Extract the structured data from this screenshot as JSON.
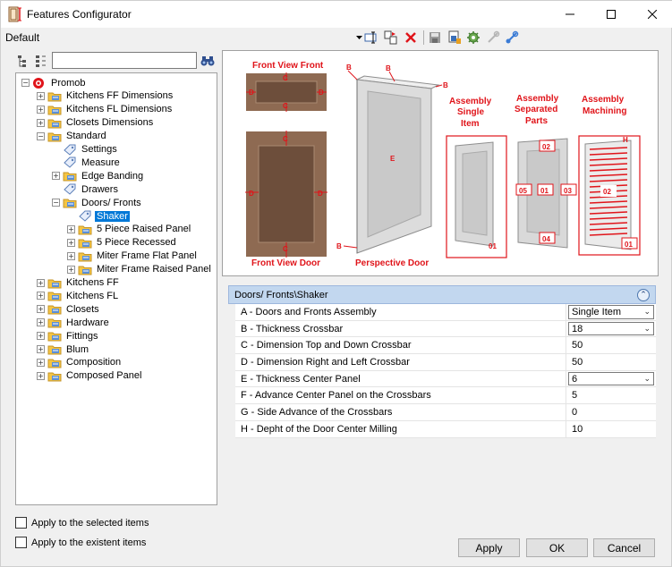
{
  "window": {
    "title": "Features Configurator"
  },
  "toolbar": {
    "preset": "Default"
  },
  "tree": {
    "items": [
      {
        "label": "Promob",
        "level": 0,
        "expander": "−",
        "type": "root"
      },
      {
        "label": "Kitchens FF Dimensions",
        "level": 1,
        "expander": "+",
        "type": "folder"
      },
      {
        "label": "Kitchens FL Dimensions",
        "level": 1,
        "expander": "+",
        "type": "folder"
      },
      {
        "label": "Closets Dimensions",
        "level": 1,
        "expander": "+",
        "type": "folder"
      },
      {
        "label": "Standard",
        "level": 1,
        "expander": "−",
        "type": "folder"
      },
      {
        "label": "Settings",
        "level": 2,
        "expander": "",
        "type": "tag"
      },
      {
        "label": "Measure",
        "level": 2,
        "expander": "",
        "type": "tag"
      },
      {
        "label": "Edge Banding",
        "level": 2,
        "expander": "+",
        "type": "folder"
      },
      {
        "label": "Drawers",
        "level": 2,
        "expander": "",
        "type": "tag"
      },
      {
        "label": "Doors/ Fronts",
        "level": 2,
        "expander": "−",
        "type": "folder"
      },
      {
        "label": "Shaker",
        "level": 3,
        "expander": "",
        "type": "tag",
        "selected": true
      },
      {
        "label": "5 Piece Raised Panel",
        "level": 3,
        "expander": "+",
        "type": "folder"
      },
      {
        "label": "5 Piece Recessed",
        "level": 3,
        "expander": "+",
        "type": "folder"
      },
      {
        "label": "Miter Frame Flat Panel",
        "level": 3,
        "expander": "+",
        "type": "folder"
      },
      {
        "label": "Miter Frame Raised Panel",
        "level": 3,
        "expander": "+",
        "type": "folder"
      },
      {
        "label": "Kitchens FF",
        "level": 1,
        "expander": "+",
        "type": "folder"
      },
      {
        "label": "Kitchens FL",
        "level": 1,
        "expander": "+",
        "type": "folder"
      },
      {
        "label": "Closets",
        "level": 1,
        "expander": "+",
        "type": "folder"
      },
      {
        "label": "Hardware",
        "level": 1,
        "expander": "+",
        "type": "folder"
      },
      {
        "label": "Fittings",
        "level": 1,
        "expander": "+",
        "type": "folder"
      },
      {
        "label": "Blum",
        "level": 1,
        "expander": "+",
        "type": "folder"
      },
      {
        "label": "Composition",
        "level": 1,
        "expander": "+",
        "type": "folder"
      },
      {
        "label": "Composed Panel",
        "level": 1,
        "expander": "+",
        "type": "folder"
      }
    ]
  },
  "diagram": {
    "front_view_front": "Front View Front",
    "front_view_door": "Front View Door",
    "perspective_door": "Perspective Door",
    "assembly_single": [
      "Assembly",
      "Single",
      "Item"
    ],
    "assembly_separated": [
      "Assembly",
      "Separated",
      "Parts"
    ],
    "assembly_machining": [
      "Assembly",
      "Machining"
    ],
    "letters": {
      "b": "B",
      "c": "C",
      "d": "D",
      "e": "E",
      "h": "H"
    },
    "parts": {
      "p01": "01",
      "p02": "02",
      "p03": "03",
      "p04": "04",
      "p05": "05"
    }
  },
  "properties": {
    "header": "Doors/ Fronts\\Shaker",
    "rows": [
      {
        "name": "A - Doors and Fronts Assembly",
        "value": "Single Item",
        "dropdown": true
      },
      {
        "name": "B - Thickness Crossbar",
        "value": "18",
        "dropdown": true
      },
      {
        "name": "C - Dimension Top and Down Crossbar",
        "value": "50",
        "dropdown": false
      },
      {
        "name": "D - Dimension Right and Left Crossbar",
        "value": "50",
        "dropdown": false
      },
      {
        "name": "E - Thickness Center Panel",
        "value": "6",
        "dropdown": true
      },
      {
        "name": "F - Advance Center Panel on the Crossbars",
        "value": "5",
        "dropdown": false
      },
      {
        "name": "G - Side Advance of the Crossbars",
        "value": "0",
        "dropdown": false
      },
      {
        "name": "H - Depht of the Door Center Milling",
        "value": "10",
        "dropdown": false
      }
    ]
  },
  "options": {
    "apply_selected": "Apply to the selected items",
    "apply_existent": "Apply to the existent items"
  },
  "buttons": {
    "apply": "Apply",
    "ok": "OK",
    "cancel": "Cancel"
  },
  "colors": {
    "accent": "#0078d7",
    "annotation": "#e0141a",
    "folder": "#f5c542"
  }
}
